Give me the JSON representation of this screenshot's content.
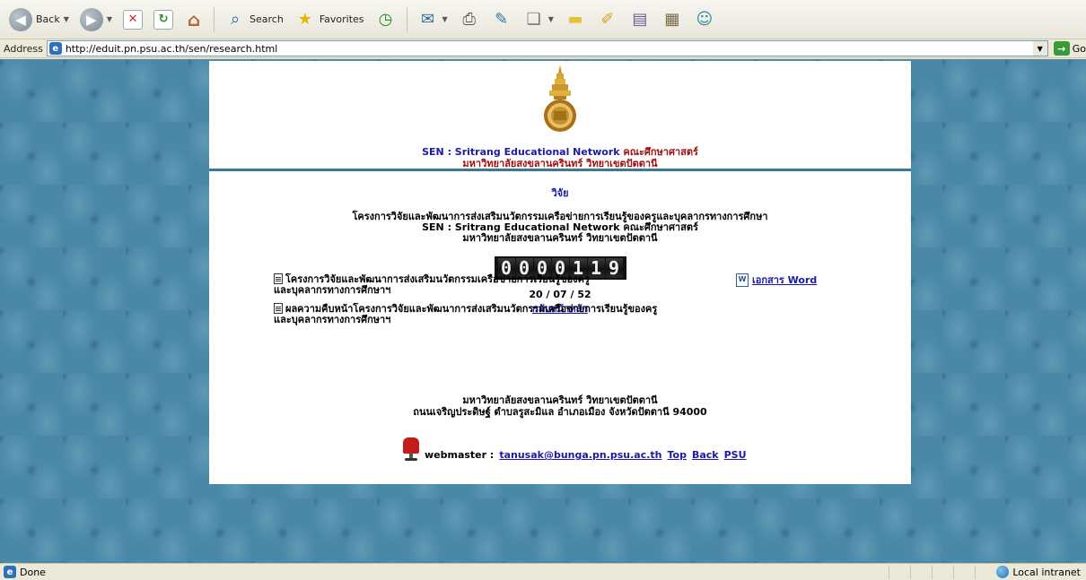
{
  "toolbar": {
    "back_label": "Back",
    "search_label": "Search",
    "favorites_label": "Favorites"
  },
  "address_bar": {
    "label": "Address",
    "url": "http://eduit.pn.psu.ac.th/sen/research.html",
    "go_label": "Go"
  },
  "header": {
    "network_name": "SEN : Sritrang Educational Network",
    "faculty": "คณะศึกษาศาสตร์",
    "university": "มหาวิทยาลัยสงขลานครินทร์ วิทยาเขตปัตตานี"
  },
  "content": {
    "section_title": "วิจัย",
    "project_line1": "โครงการวิจัยและพัฒนาการส่งเสริมนวัตกรรมเครือข่ายการเรียนรู้ของครูและบุคลากรทางการศึกษา",
    "project_line2": "SEN : Sritrang Educational Network คณะศึกษาศาสตร์",
    "project_line3": "มหาวิทยาลัยสงขลานครินทร์ วิทยาเขตปัตตานี",
    "counter_digits": [
      "0",
      "0",
      "0",
      "0",
      "1",
      "1",
      "9"
    ],
    "date": "20 / 07 / 52",
    "home_link": "กลับหน้าหลัก"
  },
  "documents": [
    {
      "line1": "โครงการวิจัยและพัฒนาการส่งเสริมนวัตกรรมเครือข่ายการเรียนรู้ของครู",
      "line2": "และบุคลากรทางการศึกษาฯ",
      "link": "เอกสาร Word"
    },
    {
      "line1": "ผลความคืบหน้าโครงการวิจัยและพัฒนาการส่งเสริมนวัตกรรมเครือข่ายการเรียนรู้ของครู",
      "line2": "และบุคลากรทางการศึกษาฯ"
    }
  ],
  "address_block": {
    "line1": "มหาวิทยาลัยสงขลานครินทร์ วิทยาเขตปัตตานี",
    "line2": "ถนนเจริญประดิษฐ์ ตำบลรูสะมิแล อำเภอเมือง จังหวัดปัตตานี 94000"
  },
  "footer": {
    "webmaster_label": "webmaster :",
    "email": "tanusak@bunga.pn.psu.ac.th",
    "links": [
      "Top",
      "Back",
      "PSU"
    ]
  },
  "statusbar": {
    "status": "Done",
    "zone": "Local intranet"
  },
  "colors": {
    "link_blue": "#1a1aa8",
    "title_red": "#a01010",
    "background_teal": "#4a88a6",
    "divider": "#3a7899"
  }
}
